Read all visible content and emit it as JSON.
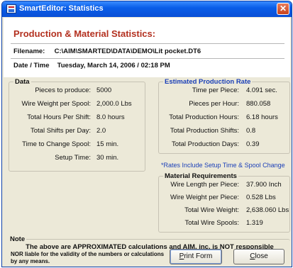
{
  "window": {
    "title": "SmartEditor: Statistics",
    "close_glyph": "✕"
  },
  "header": {
    "heading": "Production & Material Statistics:",
    "filename_label": "Filename:",
    "filename_value": "C:\\AIM\\SMARTED\\DATA\\DEMO\\Lit pocket.DT6",
    "datetime_label": "Date / Time",
    "datetime_value": "Tuesday, March 14, 2006  /  02:18 PM"
  },
  "data_group": {
    "title": "Data",
    "rows": [
      {
        "label": "Pieces to produce:",
        "value": "5000"
      },
      {
        "label": "Wire Weight per Spool:",
        "value": "2,000.0 Lbs"
      },
      {
        "label": "Total Hours Per Shift:",
        "value": "8.0 hours"
      },
      {
        "label": "Total Shifts per Day:",
        "value": "2.0"
      },
      {
        "label": "Time to Change Spool:",
        "value": "15 min."
      },
      {
        "label": "Setup Time:",
        "value": "30 min."
      }
    ]
  },
  "production_group": {
    "title": "Estimated Production Rate",
    "rows": [
      {
        "label": "Time per Piece:",
        "value": "4.091 sec."
      },
      {
        "label": "Pieces per Hour:",
        "value": "880.058"
      },
      {
        "label": "Total Production Hours:",
        "value": "6.18 hours"
      },
      {
        "label": "Total Production Shifts:",
        "value": "0.8"
      },
      {
        "label": "Total Production Days:",
        "value": "0.39"
      }
    ],
    "rates_note": "*Rates Include Setup Time & Spool Change"
  },
  "material_group": {
    "title": "Material Requirements",
    "rows": [
      {
        "label": "Wire Length per Piece:",
        "value": "37.900 Inch"
      },
      {
        "label": "Wire Weight per Piece:",
        "value": "0.528 Lbs"
      },
      {
        "label": "Total Wire Weight:",
        "value": "2,638.060 Lbs"
      },
      {
        "label": "Total Wire Spools:",
        "value": "1.319"
      }
    ]
  },
  "note_group": {
    "title": "Note",
    "line1": "The above are APPROXIMATED calculations and AIM, inc. is NOT responsible",
    "line2": "NOR liable for the validity of the numbers or calculations by any means."
  },
  "buttons": {
    "print_first": "P",
    "print_rest": "rint Form",
    "close_first": "C",
    "close_rest": "lose"
  },
  "colors": {
    "heading": "#b3301f",
    "group_title_blue": "#1a3fb8",
    "titlebar": "#0a5ee8",
    "window_bg": "#ece9d8"
  }
}
